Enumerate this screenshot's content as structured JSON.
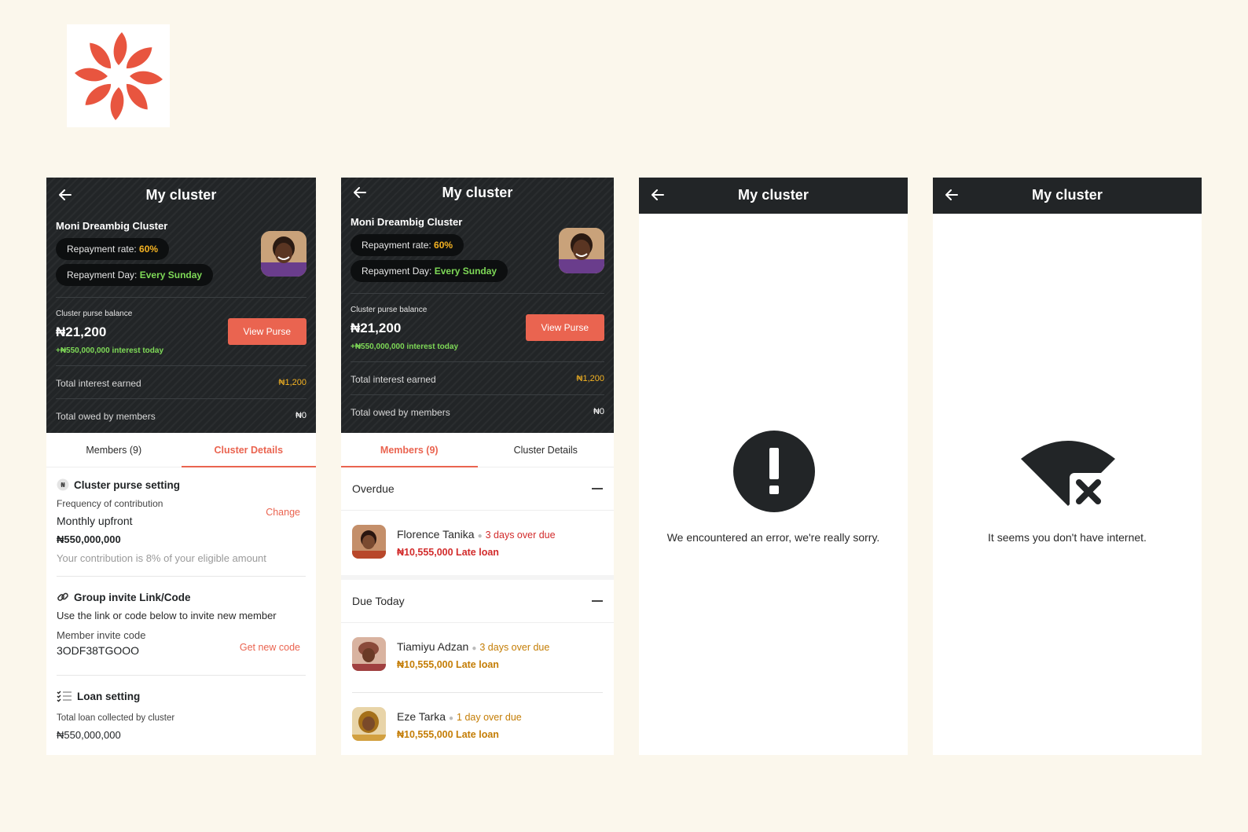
{
  "brand": {
    "color": "#ea6450"
  },
  "screen1": {
    "title": "My cluster",
    "cluster_name": "Moni Dreambig Cluster",
    "repayment_rate_label": "Repayment rate: ",
    "repayment_rate_value": "60%",
    "repayment_day_label": "Repayment Day: ",
    "repayment_day_value": "Every Sunday",
    "purse_label": "Cluster purse balance",
    "purse_amount": "₦21,200",
    "purse_interest": "+₦550,000,000 interest today",
    "view_purse": "View Purse",
    "total_interest_label": "Total interest earned",
    "total_interest_value": "₦1,200",
    "total_owed_label": "Total owed by members",
    "total_owed_value": "₦0",
    "tab_members": "Members (9)",
    "tab_details": "Cluster Details",
    "purse_setting": {
      "title": "Cluster purse setting",
      "freq_label": "Frequency of contribution",
      "freq_value": "Monthly upfront",
      "change": "Change",
      "amount": "₦550,000,000",
      "note": "Your contribution is 8% of your eligible amount"
    },
    "invite": {
      "title": "Group invite Link/Code",
      "desc": "Use the link or code below to invite new member",
      "code_label": "Member invite code",
      "code": "3ODF38TGOOO",
      "get_new": "Get new code"
    },
    "loan": {
      "title": "Loan setting",
      "collected_label": "Total loan collected by cluster",
      "collected_value": "₦550,000,000"
    }
  },
  "screen2": {
    "title": "My cluster",
    "cluster_name": "Moni Dreambig Cluster",
    "repayment_rate_label": "Repayment rate: ",
    "repayment_rate_value": "60%",
    "repayment_day_label": "Repayment Day: ",
    "repayment_day_value": "Every Sunday",
    "purse_label": "Cluster purse balance",
    "purse_amount": "₦21,200",
    "purse_interest": "+₦550,000,000 interest today",
    "view_purse": "View Purse",
    "total_interest_label": "Total interest earned",
    "total_interest_value": "₦1,200",
    "total_owed_label": "Total owed by members",
    "total_owed_value": "₦0",
    "tab_members": "Members (9)",
    "tab_details": "Cluster Details",
    "overdue_label": "Overdue",
    "due_today_label": "Due Today",
    "overdue": [
      {
        "name": "Florence Tanika",
        "due": "3 days over due",
        "loan": "₦10,555,000 Late loan"
      }
    ],
    "due_today": [
      {
        "name": "Tiamiyu Adzan",
        "due": "3 days over due",
        "loan": "₦10,555,000 Late loan"
      },
      {
        "name": "Eze Tarka",
        "due": "1 day over due",
        "loan": "₦10,555,000 Late loan"
      }
    ]
  },
  "screen3": {
    "title": "My cluster",
    "message": "We encountered an error, we're really sorry."
  },
  "screen4": {
    "title": "My cluster",
    "message": "It seems you don't have internet."
  }
}
